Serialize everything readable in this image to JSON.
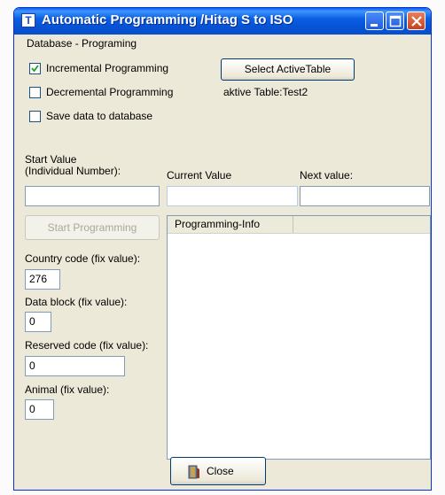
{
  "window": {
    "title": "Automatic Programming /Hitag S to ISO"
  },
  "database": {
    "caption": "Database - Programing",
    "incremental": {
      "label": "Incremental Programming",
      "checked": true
    },
    "decremental": {
      "label": "Decremental Programming",
      "checked": false
    },
    "save_db": {
      "label": "Save data to database",
      "checked": false
    },
    "select_table_label": "Select ActiveTable",
    "active_table_text": "aktive Table:Test2"
  },
  "values": {
    "start_label_line1": "Start Value",
    "start_label_line2": "(Individual Number):",
    "start_value": "",
    "current_label": "Current Value",
    "current_value": "",
    "next_label": "Next value:",
    "next_value": ""
  },
  "start_button_label": "Start Programming",
  "list": {
    "column_header": "Programming-Info"
  },
  "fields": {
    "country_label": "Country code (fix value):",
    "country_value": "276",
    "datablock_label": "Data block (fix value):",
    "datablock_value": "0",
    "reserved_label": "Reserved code (fix value):",
    "reserved_value": "0",
    "animal_label": "Animal (fix value):",
    "animal_value": "0"
  },
  "close_button_label": "Close",
  "icons": {
    "app": "app-icon",
    "minimize": "minimize-icon",
    "maximize": "maximize-icon",
    "close": "close-icon",
    "checkmark": "checkmark-icon",
    "door": "door-icon"
  },
  "colors": {
    "titlebar": "#0553d6",
    "window_bg": "#ece9d8",
    "close_button": "#c6401e"
  }
}
